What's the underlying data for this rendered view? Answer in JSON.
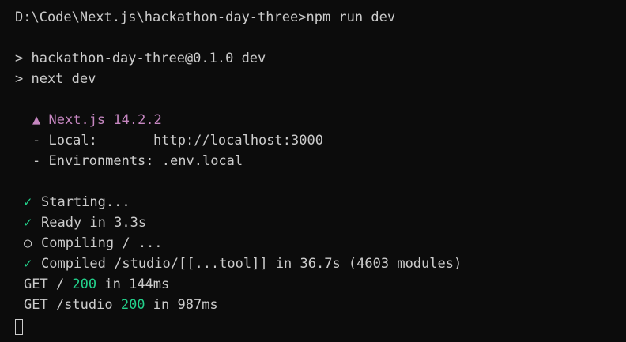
{
  "prompt": {
    "path": "D:\\Code\\Next.js\\hackathon-day-three>",
    "command": "npm run dev"
  },
  "script_lines": [
    "> hackathon-day-three@0.1.0 dev",
    "> next dev"
  ],
  "nextjs": {
    "triangle": "▲",
    "version_label": "Next.js 14.2.2",
    "local_label": "- Local:",
    "local_url": "http://localhost:3000",
    "env_label": "- Environments:",
    "env_value": ".env.local"
  },
  "status": {
    "check_icon": "check-icon",
    "circle_icon": "circle-icon",
    "starting": "Starting...",
    "ready": "Ready in 3.3s",
    "compiling": "Compiling / ...",
    "compiled": "Compiled /studio/[[...tool]] in 36.7s (4603 modules)"
  },
  "requests": [
    {
      "method_path": "GET / ",
      "code": "200",
      "time": " in 144ms"
    },
    {
      "method_path": "GET /studio ",
      "code": "200",
      "time": " in 987ms"
    }
  ],
  "colors": {
    "background": "#0c0c0c",
    "text": "#cccccc",
    "purple": "#c586c0",
    "green": "#23d18b"
  }
}
